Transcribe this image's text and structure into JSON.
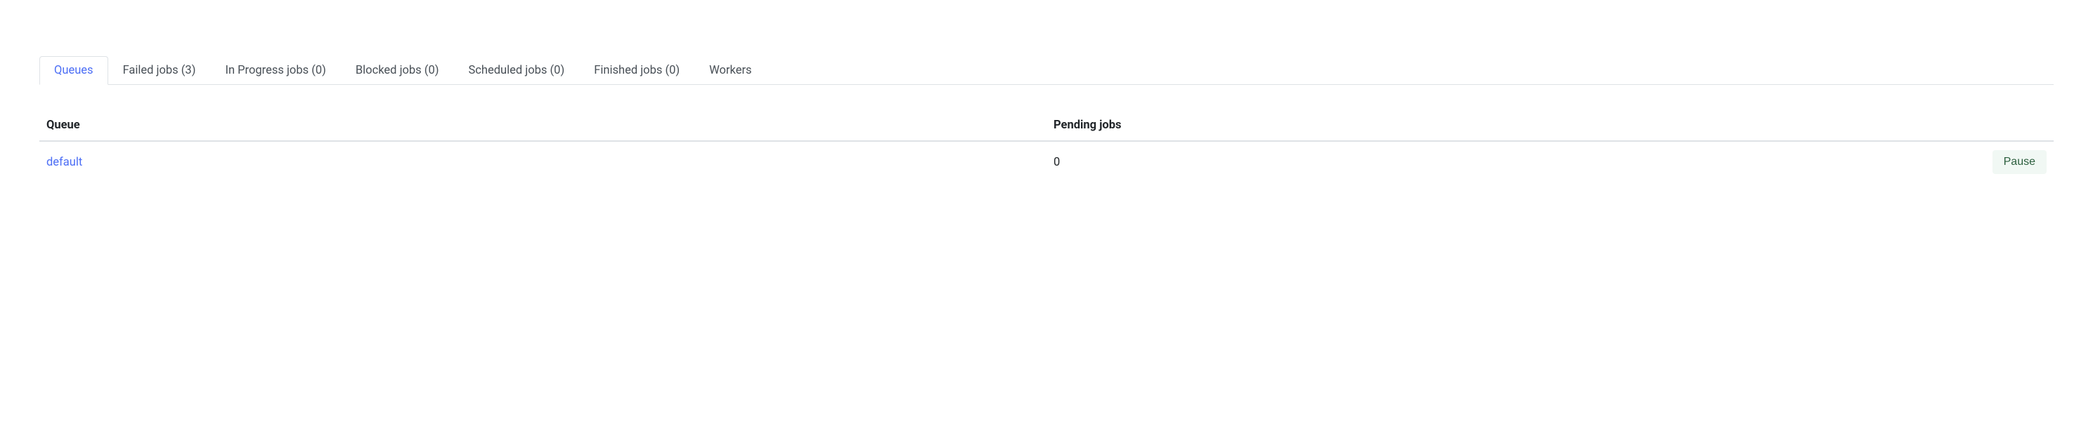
{
  "tabs": [
    {
      "label": "Queues",
      "active": true
    },
    {
      "label": "Failed jobs (3)",
      "active": false
    },
    {
      "label": "In Progress jobs (0)",
      "active": false
    },
    {
      "label": "Blocked jobs (0)",
      "active": false
    },
    {
      "label": "Scheduled jobs (0)",
      "active": false
    },
    {
      "label": "Finished jobs (0)",
      "active": false
    },
    {
      "label": "Workers",
      "active": false
    }
  ],
  "table": {
    "headers": {
      "queue": "Queue",
      "pending": "Pending jobs"
    },
    "rows": [
      {
        "name": "default",
        "pending": "0",
        "action": "Pause"
      }
    ]
  }
}
